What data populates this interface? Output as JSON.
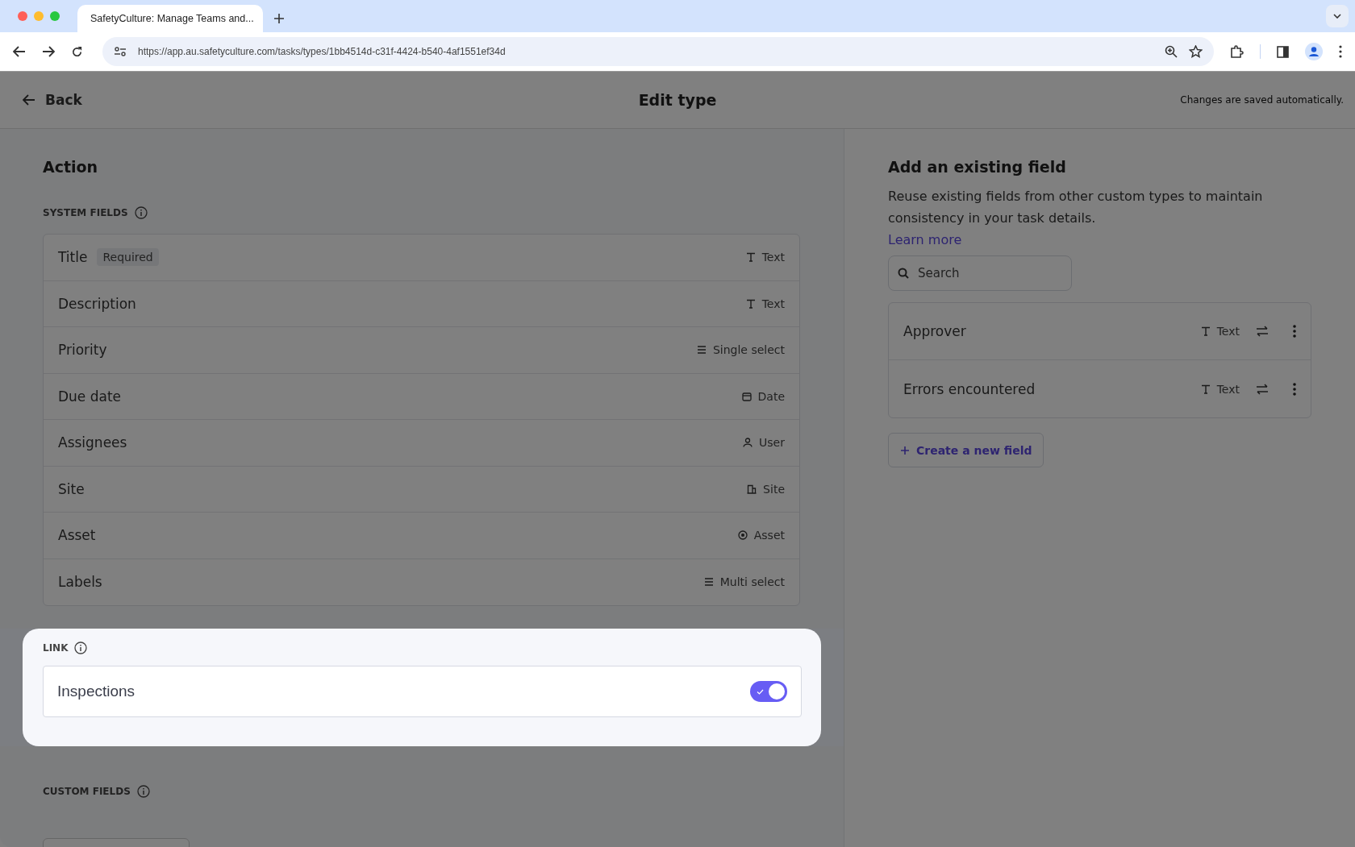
{
  "browser": {
    "tab_title": "SafetyCulture: Manage Teams and...",
    "url": "https://app.au.safetyculture.com/tasks/types/1bb4514d-c31f-4424-b540-4af1551ef34d"
  },
  "header": {
    "back": "Back",
    "title": "Edit type",
    "status": "Changes are saved automatically."
  },
  "action": {
    "heading": "Action",
    "system_fields_label": "SYSTEM FIELDS",
    "system_fields": [
      {
        "name": "Title",
        "badge": "Required",
        "type": "Text",
        "kind": "text"
      },
      {
        "name": "Description",
        "type": "Text",
        "kind": "text"
      },
      {
        "name": "Priority",
        "type": "Single select",
        "kind": "select"
      },
      {
        "name": "Due date",
        "type": "Date",
        "kind": "date"
      },
      {
        "name": "Assignees",
        "type": "User",
        "kind": "user"
      },
      {
        "name": "Site",
        "type": "Site",
        "kind": "site"
      },
      {
        "name": "Asset",
        "type": "Asset",
        "kind": "asset"
      },
      {
        "name": "Labels",
        "type": "Multi select",
        "kind": "select"
      }
    ],
    "link": {
      "label": "LINK",
      "items": [
        {
          "name": "Inspections",
          "on": true
        }
      ]
    },
    "custom_fields_label": "CUSTOM FIELDS"
  },
  "existing": {
    "heading": "Add an existing field",
    "description": "Reuse existing fields from other custom types to maintain consistency in your task details.",
    "learn_more": "Learn more",
    "search": {
      "placeholder": "Search"
    },
    "fields": [
      {
        "name": "Approver",
        "type": "Text"
      },
      {
        "name": "Errors encountered",
        "type": "Text"
      }
    ],
    "create_button": "Create a new field"
  }
}
